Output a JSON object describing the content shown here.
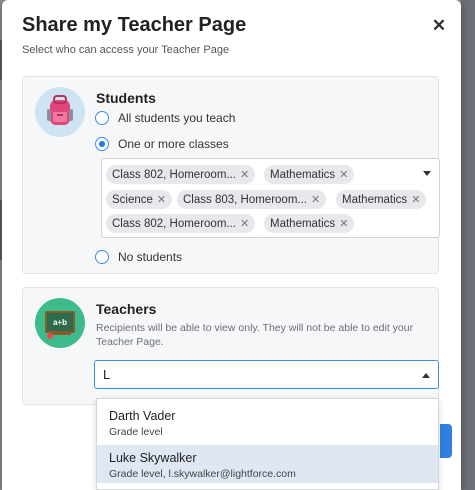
{
  "modal": {
    "title": "Share my Teacher Page",
    "subtitle": "Select who can access your Teacher Page"
  },
  "students": {
    "title": "Students",
    "options": [
      {
        "label": "All students you teach",
        "checked": false
      },
      {
        "label": "One or more classes",
        "checked": true
      },
      {
        "label": "No students",
        "checked": false
      }
    ],
    "chips": [
      "Class 802, Homeroom...",
      "Mathematics",
      "Science",
      "Class 803, Homeroom...",
      "Mathematics",
      "Class 802, Homeroom...",
      "Mathematics"
    ],
    "remove_symbol": "✕"
  },
  "teachers": {
    "title": "Teachers",
    "description": "Recipients will be able to view only. They will not be able to edit your Teacher Page.",
    "search_value": "L",
    "results": [
      {
        "name": "Darth Vader",
        "detail": "Grade level"
      },
      {
        "name": "Luke Skywalker",
        "detail": "Grade level, l.skywalker@lightforce.com"
      }
    ]
  },
  "icons": {
    "close": "close-icon",
    "students": "backpack-icon",
    "teachers": "chalkboard-icon"
  },
  "colors": {
    "accent": "#1f7be0",
    "students_avatar_bg": "#cfe4f2",
    "teachers_avatar_bg": "#3dbb8b",
    "highlight_row": "#dfe7f5"
  }
}
